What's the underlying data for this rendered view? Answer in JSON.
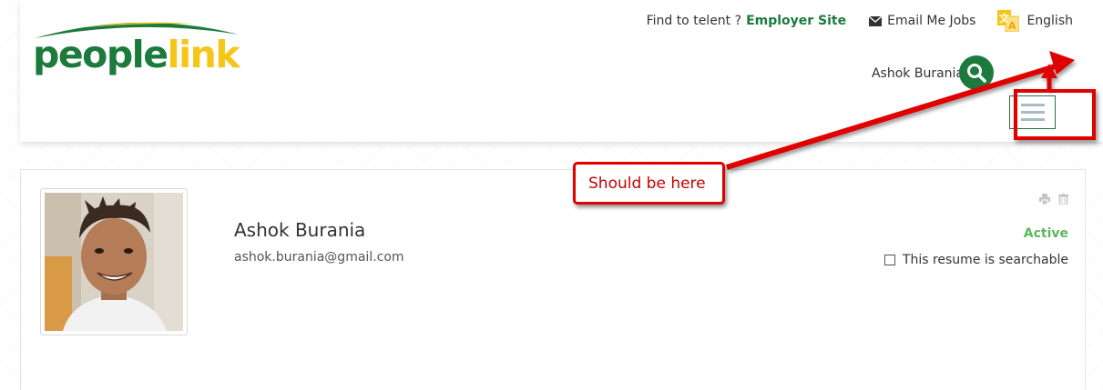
{
  "header": {
    "logo": {
      "part1": "people",
      "part2": "link"
    },
    "top_links": {
      "find_text": "Find to telent ?",
      "employer_site": "Employer Site",
      "email_me_jobs": "Email Me Jobs",
      "language": "English"
    },
    "user_name": "Ashok Burania",
    "icons": {
      "search": "search-icon",
      "menu": "hamburger-menu-icon",
      "email": "envelope-icon",
      "language": "translate-icon"
    }
  },
  "profile": {
    "name": "Ashok Burania",
    "email": "ashok.burania@gmail.com",
    "status": "Active",
    "searchable_label": "This resume is searchable",
    "searchable_checked": false,
    "icons": {
      "print": "print-icon",
      "delete": "trash-icon"
    }
  },
  "annotation": {
    "callout_text": "Should be here"
  },
  "colors": {
    "brand_green": "#1c7a3c",
    "brand_yellow": "#f5c518",
    "active_green": "#5cb85c",
    "annotation_red": "#e00000"
  }
}
